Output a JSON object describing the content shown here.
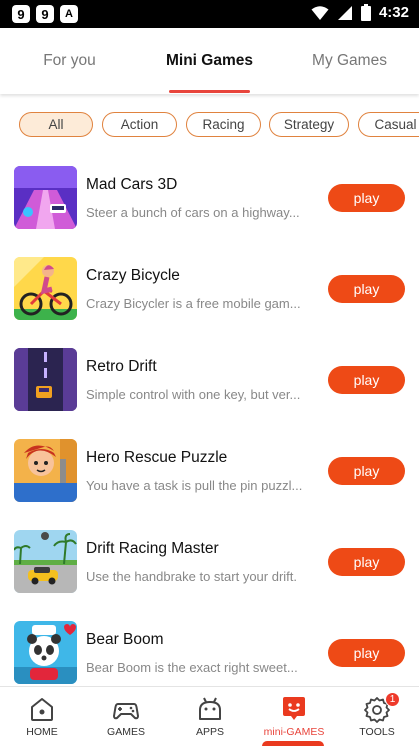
{
  "status_bar": {
    "time": "4:32",
    "left_icons": [
      "9",
      "9",
      "A"
    ],
    "right_icons": [
      "wifi-icon",
      "signal-icon",
      "battery-icon"
    ]
  },
  "tabs": [
    {
      "label": "For you",
      "active": false
    },
    {
      "label": "Mini Games",
      "active": true
    },
    {
      "label": "My Games",
      "active": false
    }
  ],
  "filters": [
    {
      "label": "All",
      "active": true
    },
    {
      "label": "Action",
      "active": false
    },
    {
      "label": "Racing",
      "active": false
    },
    {
      "label": "Strategy",
      "active": false
    },
    {
      "label": "Casual",
      "active": false
    }
  ],
  "games": [
    {
      "title": "Mad Cars 3D",
      "description": "Steer a bunch of cars on a highway...",
      "button": "play"
    },
    {
      "title": "Crazy Bicycle",
      "description": "Crazy Bicycler is a free mobile gam...",
      "button": "play"
    },
    {
      "title": "Retro Drift",
      "description": "Simple control with one key, but ver...",
      "button": "play"
    },
    {
      "title": "Hero Rescue Puzzle",
      "description": "You have a task is pull the pin puzzl...",
      "button": "play"
    },
    {
      "title": "Drift Racing Master",
      "description": "Use the handbrake to start your drift.",
      "button": "play"
    },
    {
      "title": "Bear Boom",
      "description": "Bear Boom is the exact right sweet...",
      "button": "play"
    }
  ],
  "bottom_nav": [
    {
      "label": "HOME",
      "icon": "home-icon",
      "active": false
    },
    {
      "label": "GAMES",
      "icon": "gamepad-icon",
      "active": false
    },
    {
      "label": "APPS",
      "icon": "android-icon",
      "active": false
    },
    {
      "label": "mini-GAMES",
      "icon": "mini-games-icon",
      "active": true
    },
    {
      "label": "TOOLS",
      "icon": "tools-icon",
      "active": false,
      "badge": "1"
    }
  ],
  "colors": {
    "accent": "#ee4a16",
    "tab_underline": "#e8453c",
    "chip_border": "#e0833f",
    "chip_active_bg": "#fdebd8"
  }
}
